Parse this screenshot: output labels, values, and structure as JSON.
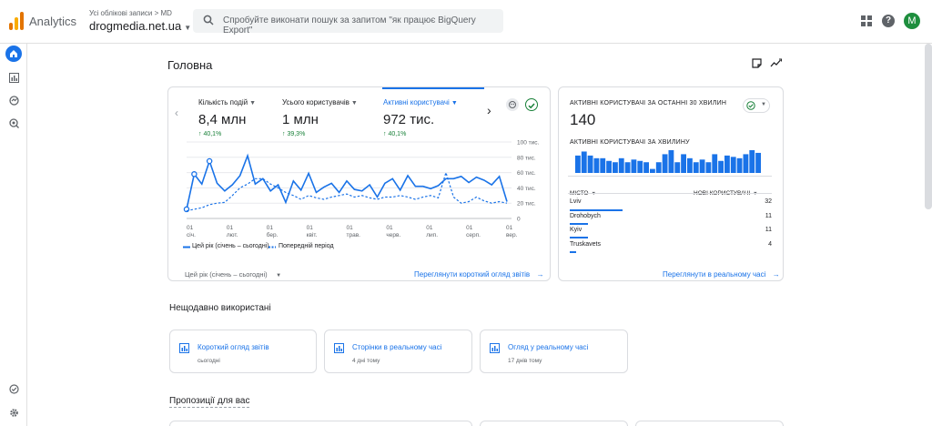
{
  "header": {
    "app_name": "Analytics",
    "account_path": "Усі облікові записи > MD",
    "property_name": "drogmedia.net.ua",
    "search_placeholder": "Спробуйте виконати пошук за запитом \"як працює BigQuery Export\"",
    "avatar_letter": "M"
  },
  "page": {
    "title": "Головна"
  },
  "overview": {
    "metrics": [
      {
        "label": "Кількість подій",
        "value": "8,4 млн",
        "change": "40,1%"
      },
      {
        "label": "Усього користувачів",
        "value": "1 млн",
        "change": "39,3%"
      },
      {
        "label": "Активні користувачі",
        "value": "972 тис.",
        "change": "40,1%"
      }
    ],
    "selected_metric_index": 2,
    "y_ticks": [
      "100 тис.",
      "80 тис.",
      "60 тис.",
      "40 тис.",
      "20 тис.",
      "0"
    ],
    "x_ticks": [
      {
        "day": "01",
        "month": "січ."
      },
      {
        "day": "01",
        "month": "лют."
      },
      {
        "day": "01",
        "month": "бер."
      },
      {
        "day": "01",
        "month": "квіт."
      },
      {
        "day": "01",
        "month": "трав."
      },
      {
        "day": "01",
        "month": "черв."
      },
      {
        "day": "01",
        "month": "лип."
      },
      {
        "day": "01",
        "month": "серп."
      },
      {
        "day": "01",
        "month": "вер."
      }
    ],
    "legend_current": "Цей рік (січень – сьогодні)",
    "legend_previous": "Попередній період",
    "date_range": "Цей рік (січень – сьогодні)",
    "view_link": "Переглянути короткий огляд звітів"
  },
  "chart_data": {
    "type": "line",
    "ylim": [
      0,
      100000
    ],
    "x_labels": [
      "01 січ.",
      "01 лют.",
      "01 бер.",
      "01 квіт.",
      "01 трав.",
      "01 черв.",
      "01 лип.",
      "01 серп.",
      "01 вер."
    ],
    "series": [
      {
        "name": "Цей рік (січень – сьогодні)",
        "color": "#1a73e8",
        "style": "solid",
        "values": [
          12000,
          58000,
          45000,
          75000,
          46000,
          36000,
          44000,
          56000,
          82000,
          45000,
          52000,
          36000,
          44000,
          21000,
          49000,
          37000,
          59000,
          34000,
          41000,
          46000,
          34000,
          49000,
          38000,
          36000,
          44000,
          28000,
          46000,
          52000,
          37000,
          56000,
          42000,
          42000,
          39000,
          43000,
          52000,
          52000,
          55000,
          47000,
          54000,
          50000,
          44000,
          55000,
          22000
        ]
      },
      {
        "name": "Попередній період",
        "color": "#1a73e8",
        "style": "dashed",
        "values": [
          10000,
          12000,
          14000,
          18000,
          20000,
          21000,
          30000,
          40000,
          45000,
          52000,
          52000,
          45000,
          40000,
          34000,
          30000,
          25000,
          30000,
          27000,
          25000,
          28000,
          30000,
          32000,
          28000,
          30000,
          27000,
          25000,
          28000,
          28000,
          30000,
          28000,
          25000,
          28000,
          30000,
          27000,
          60000,
          28000,
          20000,
          22000,
          28000,
          23000,
          20000,
          22000,
          20000
        ]
      }
    ]
  },
  "realtime": {
    "title": "АКТИВНІ КОРИСТУВАЧІ ЗА ОСТАННІ 30 ХВИЛИН",
    "value": "140",
    "per_minute_label": "АКТИВНІ КОРИСТУВАЧІ ЗА ХВИЛИНУ",
    "per_minute": [
      13,
      16,
      13,
      11,
      11,
      9,
      8,
      11,
      8,
      10,
      9,
      8,
      3,
      8,
      14,
      17,
      8,
      14,
      11,
      8,
      10,
      8,
      14,
      9,
      13,
      12,
      11,
      14,
      17,
      15
    ],
    "col_city": "МІСТО",
    "col_users": "НОВІ КОРИСТУВАЧІ",
    "rows": [
      {
        "city": "Lviv",
        "users": "32",
        "share": 1.0
      },
      {
        "city": "Drohobych",
        "users": "11",
        "share": 0.34
      },
      {
        "city": "Kyiv",
        "users": "11",
        "share": 0.34
      },
      {
        "city": "Truskavets",
        "users": "4",
        "share": 0.12
      }
    ],
    "link": "Переглянути в реальному часі"
  },
  "recent": {
    "title": "Нещодавно використані",
    "items": [
      {
        "title": "Короткий огляд звітів",
        "sub": "сьогодні"
      },
      {
        "title": "Сторінки в реальному часі",
        "sub": "4 дні тому"
      },
      {
        "title": "Огляд у реальному часі",
        "sub": "17 днів тому"
      }
    ]
  },
  "suggestions": {
    "title": "Пропозиції для вас"
  },
  "colors": {
    "accent": "#1a73e8",
    "positive": "#188038",
    "avatar": "#1e8e3e"
  }
}
